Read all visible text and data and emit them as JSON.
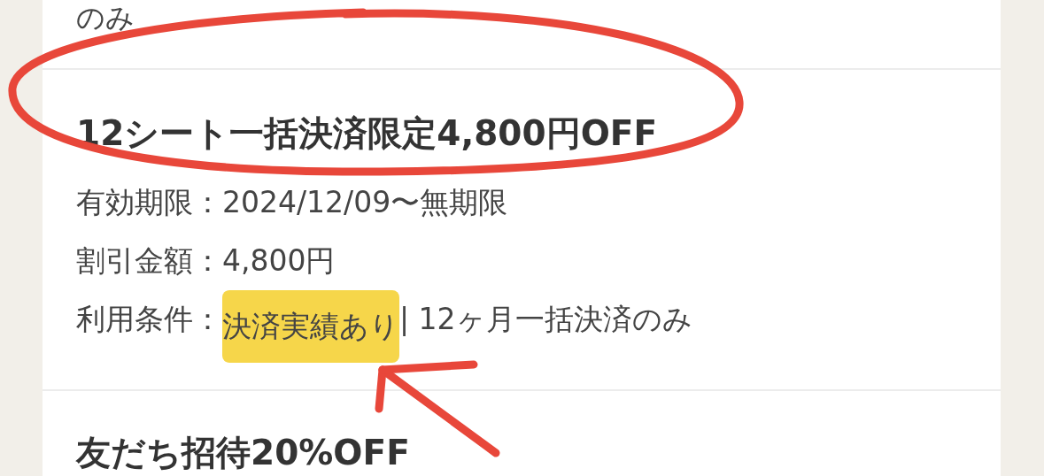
{
  "previous_item": {
    "tail": "のみ"
  },
  "coupons": [
    {
      "title": "12シート一括決済限定4,800円OFF",
      "rows": [
        {
          "kind": "plain",
          "label": "有効期限：",
          "value": " 2024/12/09〜無期限"
        },
        {
          "kind": "plain",
          "label": "割引金額：",
          "value": "4,800円"
        },
        {
          "kind": "segments",
          "label": "利用条件：",
          "segments": [
            {
              "text": "決済実績あり",
              "highlighted": true
            },
            {
              "text": " | 12ヶ月一括決済のみ",
              "highlighted": false
            }
          ]
        }
      ]
    },
    {
      "title": "友だち招待20%OFF"
    }
  ]
}
